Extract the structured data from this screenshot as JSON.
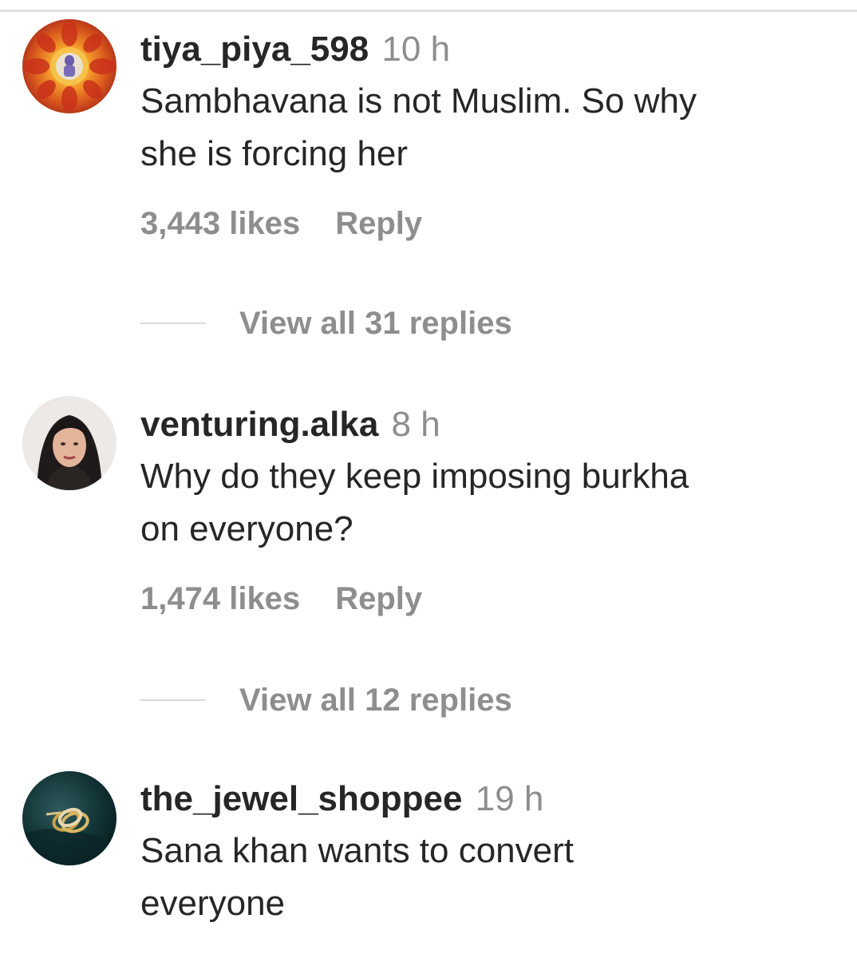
{
  "comments": [
    {
      "username": "tiya_piya_598",
      "time": "10 h",
      "text_lines": [
        "Sambhavana is not Muslim. So why",
        "she is forcing her"
      ],
      "likes": "3,443 likes",
      "reply_label": "Reply",
      "view_replies": "View all 31 replies",
      "avatar_icon": "floral-mandala-avatar"
    },
    {
      "username": "venturing.alka",
      "time": "8 h",
      "text_lines": [
        "Why do they keep imposing burkha",
        "on everyone?"
      ],
      "likes": "1,474 likes",
      "reply_label": "Reply",
      "view_replies": "View all 12 replies",
      "avatar_icon": "woman-portrait-avatar"
    },
    {
      "username": "the_jewel_shoppee",
      "time": "19 h",
      "text_lines": [
        "Sana khan wants to convert",
        "everyone"
      ],
      "avatar_icon": "rings-avatar"
    }
  ],
  "colors": {
    "primary_text": "#262626",
    "secondary_text": "#8e8e8e",
    "divider": "#dbdbdb"
  }
}
